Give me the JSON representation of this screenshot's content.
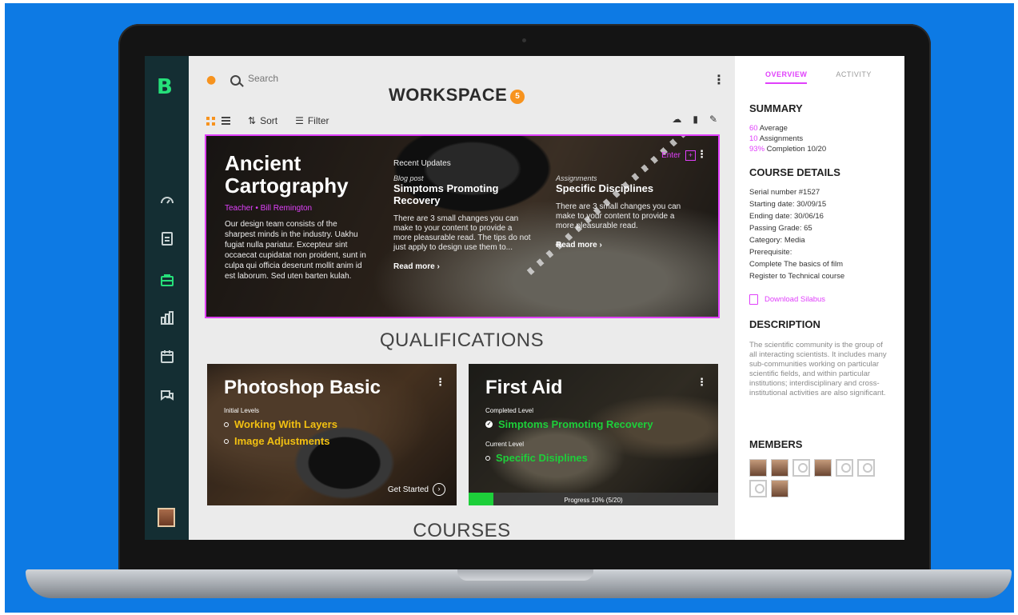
{
  "app": {
    "logo": "B",
    "workspace_title": "WORKSPACE",
    "workspace_badge": "5"
  },
  "search": {
    "placeholder": "Search"
  },
  "toolbar": {
    "sort_label": "Sort",
    "filter_label": "Filter"
  },
  "sidebar": {
    "items": [
      {
        "icon": "dashboard-gauge-icon"
      },
      {
        "icon": "clipboard-checklist-icon"
      },
      {
        "icon": "briefcase-icon",
        "active": true
      },
      {
        "icon": "buildings-chart-icon"
      },
      {
        "icon": "calendar-icon"
      },
      {
        "icon": "chat-bubbles-icon"
      }
    ]
  },
  "hero": {
    "title": "Ancient Cartography",
    "teacher": "Teacher • Bill Remington",
    "description": "Our design team consists of the sharpest minds in the industry. Uakhu fugiat nulla pariatur. Excepteur sint occaecat cupidatat non proident, sunt in culpa qui officia deserunt mollit anim id est laborum. Sed uten barten kulah.",
    "recent_label": "Recent Updates",
    "enter_label": "Enter",
    "updates": [
      {
        "kind": "Blog post",
        "title": "Simptoms Promoting Recovery",
        "text": "There are 3 small changes you can make to your content to provide a more pleasurable read. The tips do not just apply to design use them to...",
        "read_more": "Read more ›"
      },
      {
        "kind": "Assignments",
        "title": "Specific Disciplines",
        "text": "There are 3 small changes you can make to your content to provide a more pleasurable read.",
        "read_more": "Read more ›"
      }
    ]
  },
  "sections": {
    "qualifications": "QUALIFICATIONS",
    "courses": "COURSES"
  },
  "qualifications": [
    {
      "title": "Photoshop Basic",
      "level_label": "Initial Levels",
      "items": [
        "Working With Layers",
        "Image Adjustments"
      ],
      "item_color": "#f2c011",
      "cta": "Get Started"
    },
    {
      "title": "First Aid",
      "completed_label": "Completed Level",
      "completed_item": "Simptoms Promoting Recovery",
      "current_label": "Current Level",
      "current_item": "Specific Disiplines",
      "item_color": "#1dcf3a",
      "progress_text": "Progress 10% (5/20)",
      "progress_fraction": 0.1
    }
  ],
  "panel": {
    "tabs": [
      {
        "label": "OVERVIEW",
        "active": true
      },
      {
        "label": "ACTIVITY",
        "active": false
      }
    ],
    "summary_heading": "SUMMARY",
    "summary": [
      {
        "value": "60",
        "label": "Average"
      },
      {
        "value": "10",
        "label": "Assignments"
      },
      {
        "value": "93%",
        "label": "Completion 10/20"
      }
    ],
    "details_heading": "COURSE DETAILS",
    "details": [
      "Serial number #1527",
      "Starting date: 30/09/15",
      "Ending date: 30/06/16",
      "Passing Grade: 65",
      "Category: Media",
      "Prerequisite:",
      "Complete The basics of film",
      "Register to Technical course"
    ],
    "download_label": "Download Silabus",
    "description_heading": "DESCRIPTION",
    "description": "The scientific community is the group of all interacting scientists. It includes many sub-communities working on particular scientific fields, and within particular institutions; interdisciplinary and cross-institutional activities are also significant.",
    "members_heading": "MEMBERS"
  },
  "colors": {
    "accent": "#e040fb",
    "brand": "#26e07a",
    "badge": "#f7931e",
    "background": "#0d7ae4"
  }
}
